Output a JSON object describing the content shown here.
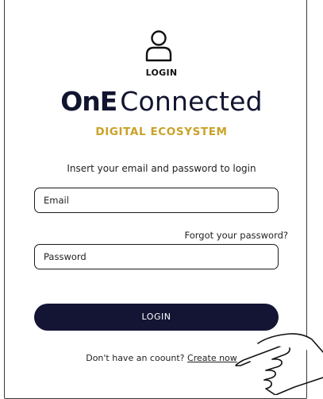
{
  "header": {
    "login_label": "LOGIN"
  },
  "logo": {
    "one_part": "OnE",
    "connected_part": "Connected",
    "tagline": "DIGITAL ECOSYSTEM"
  },
  "form": {
    "instruction": "Insert your email and password to login",
    "email_placeholder": "Email",
    "forgot_password": "Forgot your password?",
    "password_placeholder": "Password",
    "login_button": "LOGIN"
  },
  "footer": {
    "no_account_text": "Don't have an coount?",
    "create_link": "Create now"
  },
  "icons": {
    "user": "user-icon",
    "hand": "pointing-hand-icon"
  },
  "colors": {
    "navy": "#141535",
    "gold": "#c9a227",
    "border": "#1a1a1a"
  }
}
